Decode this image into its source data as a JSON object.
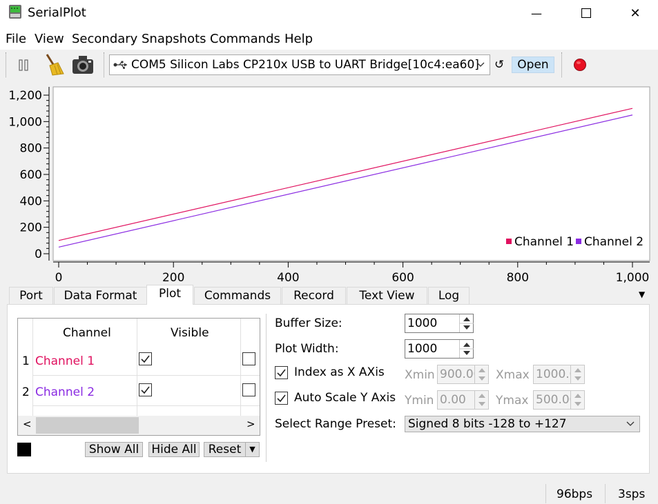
{
  "window": {
    "title": "SerialPlot",
    "minimize_glyph": "—",
    "close_glyph": "✕"
  },
  "menu": [
    "File",
    "View",
    "Secondary",
    "Snapshots",
    "Commands",
    "Help"
  ],
  "toolbar": {
    "pause_icon": "pause-icon",
    "clear_icon": "broom-icon",
    "snapshot_icon": "camera-icon",
    "port": "COM5 Silicon Labs CP210x USB to UART Bridge[10c4:ea60]",
    "refresh_glyph": "↺",
    "open_label": "Open",
    "record_icon": "record-icon",
    "record_color": "#e81123"
  },
  "chart_data": {
    "type": "line",
    "x": [
      0,
      1000
    ],
    "series": [
      {
        "name": "Channel 1",
        "color": "#e0115f",
        "x": [
          0,
          1000
        ],
        "values": [
          100,
          1100
        ]
      },
      {
        "name": "Channel 2",
        "color": "#8a2be2",
        "x": [
          0,
          1000
        ],
        "values": [
          50,
          1050
        ]
      }
    ],
    "xlim": [
      0,
      1000
    ],
    "ylim": [
      0,
      1200
    ],
    "xticks": [
      "0",
      "200",
      "400",
      "600",
      "800",
      "1,000"
    ],
    "yticks": [
      "0",
      "200",
      "400",
      "600",
      "800",
      "1,000",
      "1,200"
    ],
    "legend": "bottom-right",
    "grid": false
  },
  "tabs": [
    "Port",
    "Data Format",
    "Plot",
    "Commands",
    "Record",
    "Text View",
    "Log"
  ],
  "active_tab": "Plot",
  "channel_table": {
    "headers": [
      "Channel",
      "Visible"
    ],
    "rows": [
      {
        "index": "1",
        "name": "Channel 1",
        "color": "#e0115f",
        "visible": true
      },
      {
        "index": "2",
        "name": "Channel 2",
        "color": "#8a2be2",
        "visible": true
      }
    ],
    "scroll_left": "<",
    "scroll_right": ">"
  },
  "channel_buttons": {
    "show_all": "Show All",
    "hide_all": "Hide All",
    "reset": "Reset",
    "swatch_color": "#000000"
  },
  "plot_settings": {
    "buffer_size_label": "Buffer Size:",
    "buffer_size": "1000",
    "plot_width_label": "Plot Width:",
    "plot_width": "1000",
    "index_as_x_label": "Index as X AXis",
    "index_as_x": true,
    "xmin_label": "Xmin",
    "xmin": "900.00",
    "xmax_label": "Xmax",
    "xmax": "1000.00",
    "auto_scale_y_label": "Auto Scale Y Axis",
    "auto_scale_y": true,
    "ymin_label": "Ymin",
    "ymin": "0.00",
    "ymax_label": "Ymax",
    "ymax": "500.00",
    "range_preset_label": "Select Range Preset:",
    "range_preset": "Signed 8 bits -128 to +127"
  },
  "status": {
    "bps": "96bps",
    "sps": "3sps"
  }
}
